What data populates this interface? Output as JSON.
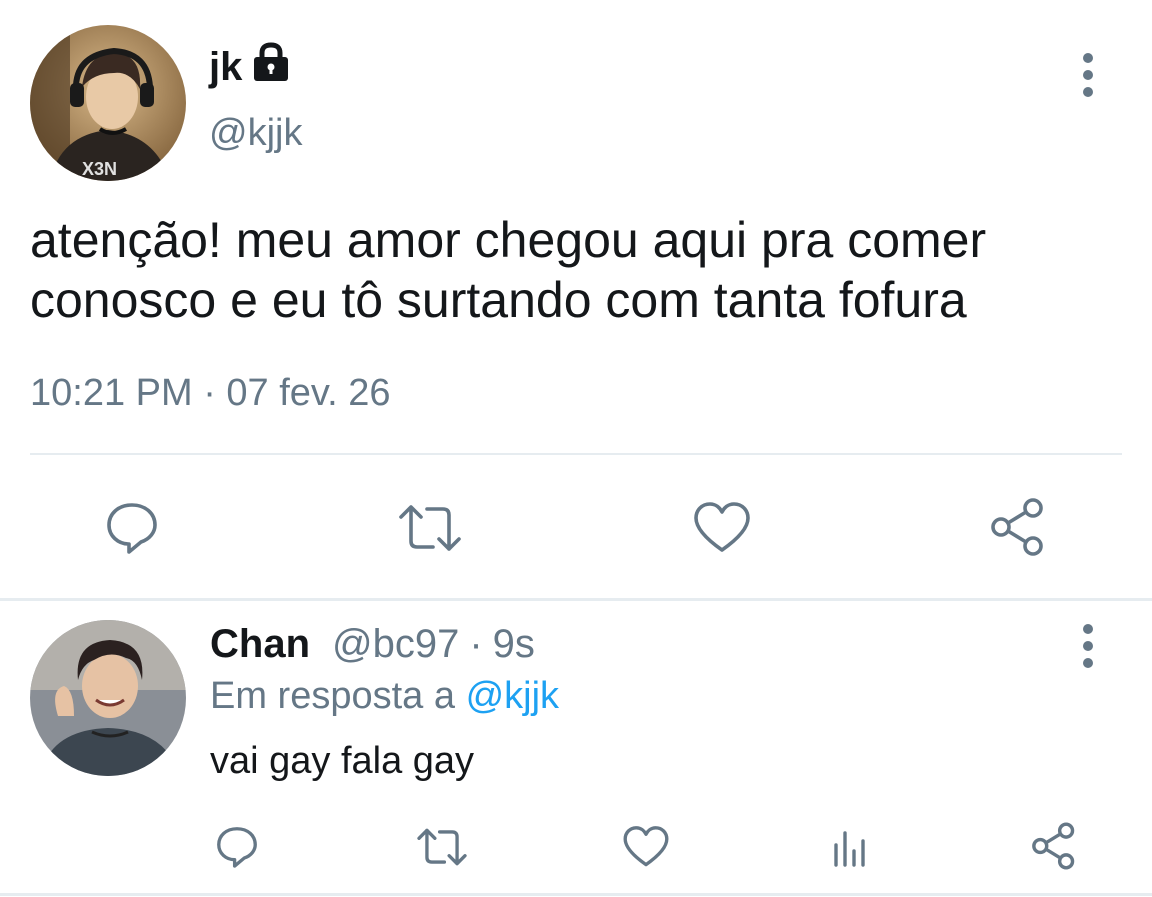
{
  "main_tweet": {
    "display_name": "jk",
    "handle": "@kjjk",
    "text": "atenção! meu amor chegou aqui pra comer conosco e eu tô surtando com tanta fofura",
    "timestamp": "10:21 PM · 07 fev. 26",
    "protected_icon": "lock-icon",
    "actions": [
      "reply-icon",
      "retweet-icon",
      "like-icon",
      "share-icon"
    ]
  },
  "reply_tweet": {
    "display_name": "Chan",
    "handle": "@bc97",
    "separator": "·",
    "time_ago": "9s",
    "replying_prefix": "Em resposta a",
    "replying_to": "@kjjk",
    "text": "vai gay fala gay",
    "actions": [
      "reply-icon",
      "retweet-icon",
      "like-icon",
      "analytics-icon",
      "share-icon"
    ]
  },
  "colors": {
    "text_primary": "#14171a",
    "text_secondary": "#657786",
    "link": "#1da1f2",
    "divider": "#e6ecf0"
  }
}
